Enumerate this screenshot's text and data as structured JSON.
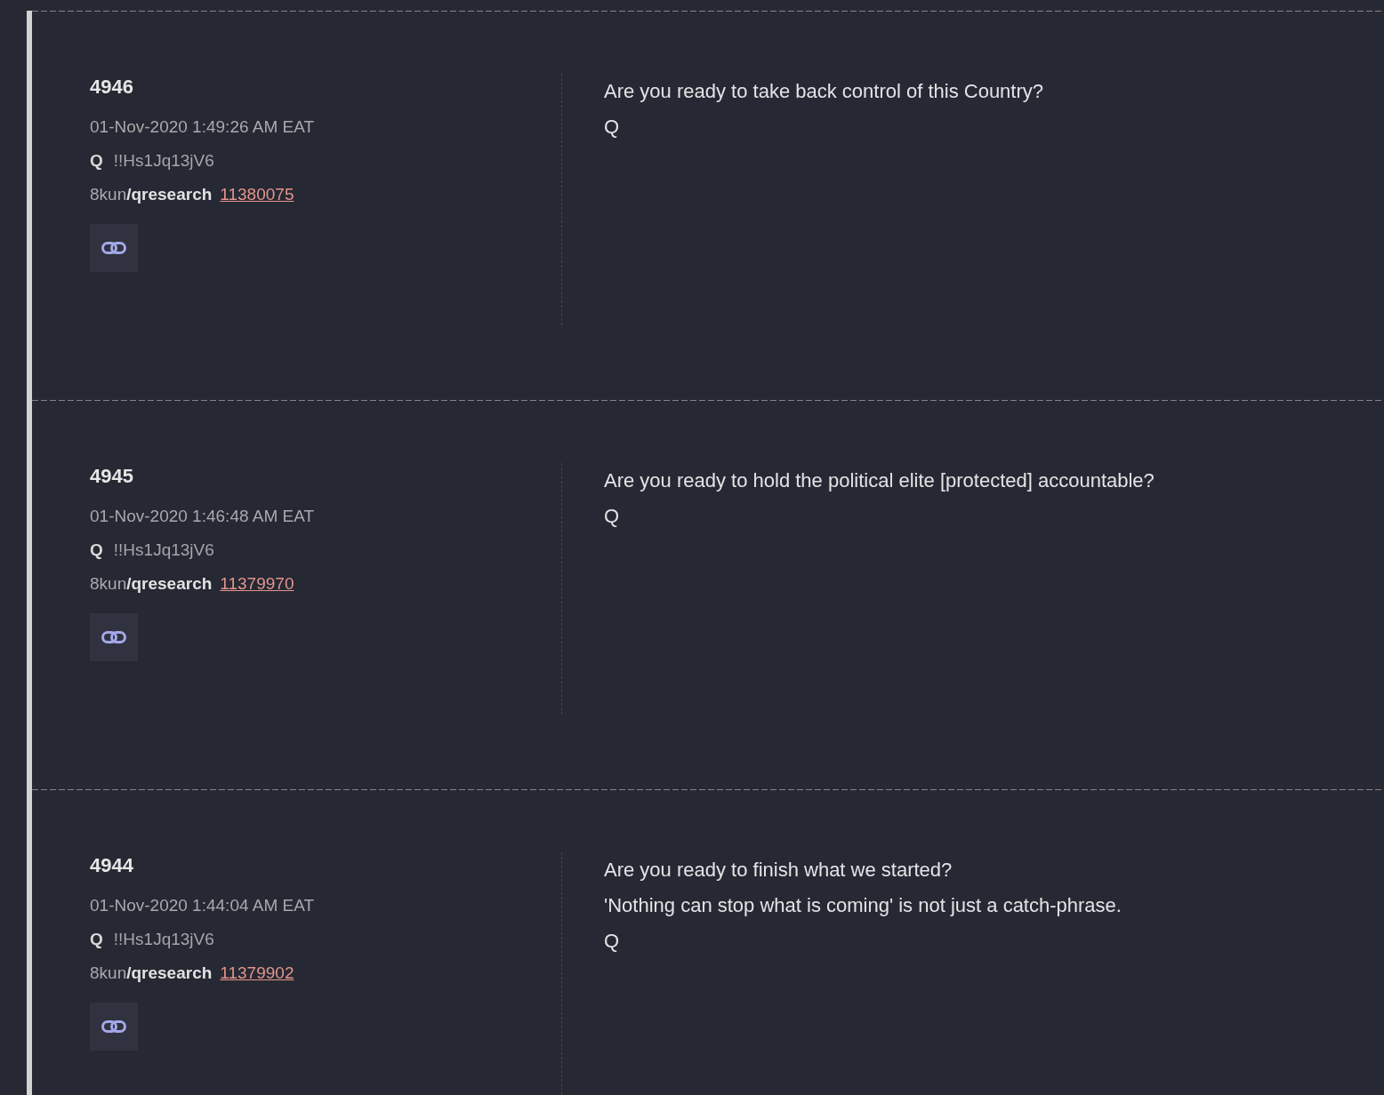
{
  "posts": [
    {
      "number": "4946",
      "timestamp": "01-Nov-2020 1:49:26 AM EAT",
      "author": "Q",
      "tripcode": "!!Hs1Jq13jV6",
      "site": "8kun",
      "board": "/qresearch",
      "post_link": "11380075",
      "lines": [
        "Are you ready to take back control of this Country?",
        "Q"
      ]
    },
    {
      "number": "4945",
      "timestamp": "01-Nov-2020 1:46:48 AM EAT",
      "author": "Q",
      "tripcode": "!!Hs1Jq13jV6",
      "site": "8kun",
      "board": "/qresearch",
      "post_link": "11379970",
      "lines": [
        "Are you ready to hold the political elite [protected] accountable?",
        "Q"
      ]
    },
    {
      "number": "4944",
      "timestamp": "01-Nov-2020 1:44:04 AM EAT",
      "author": "Q",
      "tripcode": "!!Hs1Jq13jV6",
      "site": "8kun",
      "board": "/qresearch",
      "post_link": "11379902",
      "lines": [
        "Are you ready to finish what we started?",
        "'Nothing can stop what is coming' is not just a catch-phrase.",
        "Q"
      ]
    }
  ]
}
